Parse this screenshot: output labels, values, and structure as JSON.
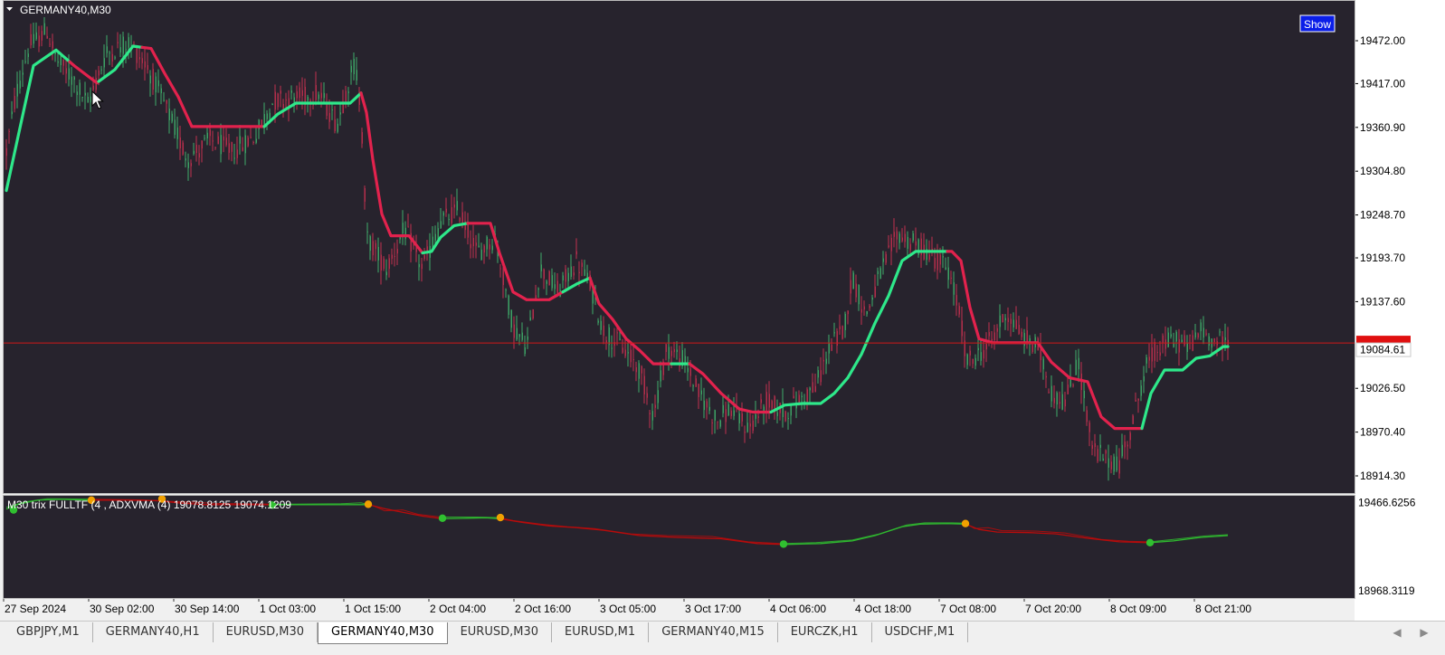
{
  "app": {
    "title": "GERMANY40,M30",
    "show_button": "Show"
  },
  "colors": {
    "background": "#27232d",
    "bull_candle": "#3fae6a",
    "bear_candle": "#c2304f",
    "trend_up": "#2ee88a",
    "trend_down": "#e2224d",
    "price_line": "#d01818",
    "axis_text": "#000000",
    "indicator_up": "#2fb82f",
    "indicator_down": "#b80b0b",
    "dot_green": "#30c030",
    "dot_orange": "#f0a000"
  },
  "chart_data": [
    {
      "type": "candlestick",
      "title": "GERMANY40,M30",
      "ylabels": [
        "19472.00",
        "19417.00",
        "19360.90",
        "19304.80",
        "19248.70",
        "19193.70",
        "19137.60",
        "19026.50",
        "18970.40",
        "18914.30"
      ],
      "yticks": [
        19472.0,
        19417.0,
        19360.9,
        19304.8,
        19248.7,
        19193.7,
        19137.6,
        19026.5,
        18970.4,
        18914.3
      ],
      "ylim": [
        18900,
        19520
      ],
      "current_price": "19084.61",
      "current_price_value": 19084.61,
      "trend_line_points": [
        [
          0,
          19280
        ],
        [
          30,
          19440
        ],
        [
          55,
          19460
        ],
        [
          75,
          19440
        ],
        [
          100,
          19418
        ],
        [
          120,
          19435
        ],
        [
          140,
          19465
        ],
        [
          160,
          19462
        ],
        [
          175,
          19430
        ],
        [
          190,
          19400
        ],
        [
          205,
          19362
        ],
        [
          225,
          19362
        ],
        [
          255,
          19362
        ],
        [
          285,
          19362
        ],
        [
          300,
          19378
        ],
        [
          320,
          19392
        ],
        [
          345,
          19392
        ],
        [
          365,
          19392
        ],
        [
          380,
          19392
        ],
        [
          392,
          19405
        ],
        [
          398,
          19380
        ],
        [
          405,
          19320
        ],
        [
          415,
          19250
        ],
        [
          425,
          19222
        ],
        [
          445,
          19222
        ],
        [
          460,
          19200
        ],
        [
          470,
          19202
        ],
        [
          480,
          19220
        ],
        [
          495,
          19235
        ],
        [
          510,
          19238
        ],
        [
          535,
          19238
        ],
        [
          545,
          19200
        ],
        [
          560,
          19150
        ],
        [
          575,
          19140
        ],
        [
          600,
          19140
        ],
        [
          615,
          19150
        ],
        [
          630,
          19160
        ],
        [
          645,
          19168
        ],
        [
          655,
          19135
        ],
        [
          670,
          19115
        ],
        [
          685,
          19090
        ],
        [
          700,
          19075
        ],
        [
          715,
          19058
        ],
        [
          735,
          19058
        ],
        [
          755,
          19058
        ],
        [
          770,
          19045
        ],
        [
          790,
          19020
        ],
        [
          810,
          19000
        ],
        [
          825,
          18996
        ],
        [
          845,
          18996
        ],
        [
          860,
          19005
        ],
        [
          880,
          19007
        ],
        [
          900,
          19007
        ],
        [
          915,
          19020
        ],
        [
          930,
          19040
        ],
        [
          945,
          19070
        ],
        [
          960,
          19110
        ],
        [
          975,
          19145
        ],
        [
          990,
          19190
        ],
        [
          1005,
          19202
        ],
        [
          1025,
          19202
        ],
        [
          1045,
          19202
        ],
        [
          1055,
          19190
        ],
        [
          1065,
          19130
        ],
        [
          1075,
          19090
        ],
        [
          1090,
          19085
        ],
        [
          1110,
          19085
        ],
        [
          1140,
          19085
        ],
        [
          1155,
          19060
        ],
        [
          1175,
          19040
        ],
        [
          1195,
          19035
        ],
        [
          1210,
          18990
        ],
        [
          1225,
          18975
        ],
        [
          1245,
          18975
        ],
        [
          1255,
          18975
        ],
        [
          1265,
          19020
        ],
        [
          1280,
          19050
        ],
        [
          1300,
          19050
        ],
        [
          1315,
          19065
        ],
        [
          1330,
          19068
        ],
        [
          1345,
          19080
        ],
        [
          1350,
          19080
        ]
      ],
      "trend_segments": [
        {
          "from": 0,
          "to": 70,
          "trend": "up"
        },
        {
          "from": 70,
          "to": 102,
          "trend": "down"
        },
        {
          "from": 102,
          "to": 150,
          "trend": "up"
        },
        {
          "from": 150,
          "to": 285,
          "trend": "down"
        },
        {
          "from": 285,
          "to": 392,
          "trend": "up"
        },
        {
          "from": 392,
          "to": 460,
          "trend": "down"
        },
        {
          "from": 460,
          "to": 510,
          "trend": "up"
        },
        {
          "from": 510,
          "to": 615,
          "trend": "down"
        },
        {
          "from": 615,
          "to": 645,
          "trend": "up"
        },
        {
          "from": 645,
          "to": 735,
          "trend": "down"
        },
        {
          "from": 735,
          "to": 755,
          "trend": "up"
        },
        {
          "from": 755,
          "to": 845,
          "trend": "down"
        },
        {
          "from": 845,
          "to": 1040,
          "trend": "up"
        },
        {
          "from": 1040,
          "to": 1255,
          "trend": "down"
        },
        {
          "from": 1255,
          "to": 1350,
          "trend": "up"
        }
      ],
      "candle_path": [
        [
          0,
          19330
        ],
        [
          10,
          19400
        ],
        [
          25,
          19465
        ],
        [
          45,
          19485
        ],
        [
          55,
          19448
        ],
        [
          75,
          19420
        ],
        [
          90,
          19390
        ],
        [
          110,
          19455
        ],
        [
          135,
          19470
        ],
        [
          155,
          19440
        ],
        [
          175,
          19390
        ],
        [
          200,
          19320
        ],
        [
          225,
          19345
        ],
        [
          250,
          19330
        ],
        [
          275,
          19350
        ],
        [
          295,
          19395
        ],
        [
          330,
          19400
        ],
        [
          345,
          19405
        ],
        [
          365,
          19365
        ],
        [
          385,
          19445
        ],
        [
          392,
          19380
        ],
        [
          398,
          19220
        ],
        [
          420,
          19180
        ],
        [
          440,
          19230
        ],
        [
          460,
          19180
        ],
        [
          480,
          19240
        ],
        [
          500,
          19255
        ],
        [
          520,
          19200
        ],
        [
          540,
          19220
        ],
        [
          560,
          19105
        ],
        [
          575,
          19080
        ],
        [
          590,
          19180
        ],
        [
          610,
          19150
        ],
        [
          630,
          19190
        ],
        [
          645,
          19160
        ],
        [
          660,
          19100
        ],
        [
          680,
          19080
        ],
        [
          700,
          19050
        ],
        [
          715,
          18990
        ],
        [
          730,
          19080
        ],
        [
          750,
          19060
        ],
        [
          765,
          19020
        ],
        [
          785,
          18985
        ],
        [
          800,
          19000
        ],
        [
          820,
          18975
        ],
        [
          840,
          19010
        ],
        [
          860,
          18995
        ],
        [
          880,
          19015
        ],
        [
          895,
          19030
        ],
        [
          910,
          19080
        ],
        [
          925,
          19100
        ],
        [
          935,
          19170
        ],
        [
          950,
          19120
        ],
        [
          965,
          19170
        ],
        [
          985,
          19225
        ],
        [
          1005,
          19210
        ],
        [
          1020,
          19200
        ],
        [
          1040,
          19180
        ],
        [
          1052,
          19130
        ],
        [
          1062,
          19060
        ],
        [
          1075,
          19070
        ],
        [
          1090,
          19090
        ],
        [
          1105,
          19125
        ],
        [
          1125,
          19090
        ],
        [
          1140,
          19080
        ],
        [
          1155,
          19020
        ],
        [
          1170,
          19010
        ],
        [
          1185,
          19060
        ],
        [
          1200,
          18950
        ],
        [
          1215,
          18935
        ],
        [
          1230,
          18930
        ],
        [
          1245,
          18985
        ],
        [
          1258,
          19050
        ],
        [
          1270,
          19075
        ],
        [
          1290,
          19090
        ],
        [
          1305,
          19080
        ],
        [
          1320,
          19100
        ],
        [
          1335,
          19088
        ],
        [
          1350,
          19085
        ]
      ]
    },
    {
      "type": "line",
      "title": "M30 trix FULLTF (4 , ADXVMA (4) 19078.8125 19074.1209",
      "ylabels": [
        "19466.6256",
        "18968.3119"
      ],
      "yticks": [
        19466.6256,
        18968.3119
      ],
      "ylim": [
        18955,
        19485
      ],
      "xlabels": [
        "27 Sep 2024",
        "30 Sep 02:00",
        "30 Sep 14:00",
        "1 Oct 03:00",
        "1 Oct 15:00",
        "2 Oct 04:00",
        "2 Oct 16:00",
        "3 Oct 05:00",
        "3 Oct 17:00",
        "4 Oct 06:00",
        "4 Oct 18:00",
        "7 Oct 08:00",
        "7 Oct 20:00",
        "8 Oct 09:00",
        "8 Oct 21:00"
      ],
      "series_main": [
        [
          0,
          19430
        ],
        [
          15,
          19460
        ],
        [
          35,
          19480
        ],
        [
          60,
          19485
        ],
        [
          90,
          19480
        ],
        [
          130,
          19480
        ],
        [
          165,
          19478
        ],
        [
          190,
          19465
        ],
        [
          220,
          19455
        ],
        [
          260,
          19455
        ],
        [
          294,
          19455
        ],
        [
          320,
          19455
        ],
        [
          360,
          19455
        ],
        [
          385,
          19455
        ],
        [
          400,
          19455
        ],
        [
          420,
          19430
        ],
        [
          440,
          19410
        ],
        [
          460,
          19390
        ],
        [
          482,
          19375
        ],
        [
          510,
          19378
        ],
        [
          530,
          19380
        ],
        [
          545,
          19375
        ],
        [
          570,
          19355
        ],
        [
          600,
          19335
        ],
        [
          630,
          19325
        ],
        [
          660,
          19310
        ],
        [
          700,
          19280
        ],
        [
          740,
          19270
        ],
        [
          790,
          19262
        ],
        [
          830,
          19235
        ],
        [
          860,
          19230
        ],
        [
          900,
          19235
        ],
        [
          935,
          19250
        ],
        [
          960,
          19280
        ],
        [
          990,
          19330
        ],
        [
          1010,
          19345
        ],
        [
          1040,
          19348
        ],
        [
          1060,
          19345
        ],
        [
          1075,
          19315
        ],
        [
          1095,
          19300
        ],
        [
          1130,
          19297
        ],
        [
          1160,
          19290
        ],
        [
          1195,
          19265
        ],
        [
          1230,
          19245
        ],
        [
          1264,
          19240
        ],
        [
          1290,
          19250
        ],
        [
          1320,
          19270
        ],
        [
          1350,
          19280
        ]
      ],
      "series_shadow": [
        [
          0,
          19440
        ],
        [
          20,
          19470
        ],
        [
          45,
          19488
        ],
        [
          75,
          19487
        ],
        [
          100,
          19485
        ],
        [
          150,
          19482
        ],
        [
          180,
          19474
        ],
        [
          200,
          19470
        ],
        [
          230,
          19462
        ],
        [
          300,
          19457
        ],
        [
          370,
          19460
        ],
        [
          392,
          19465
        ],
        [
          405,
          19450
        ],
        [
          418,
          19420
        ],
        [
          438,
          19425
        ],
        [
          455,
          19400
        ],
        [
          480,
          19385
        ],
        [
          520,
          19385
        ],
        [
          545,
          19382
        ],
        [
          560,
          19365
        ],
        [
          590,
          19345
        ],
        [
          620,
          19330
        ],
        [
          650,
          19320
        ],
        [
          690,
          19290
        ],
        [
          730,
          19280
        ],
        [
          780,
          19275
        ],
        [
          820,
          19245
        ],
        [
          855,
          19235
        ],
        [
          895,
          19240
        ],
        [
          935,
          19255
        ],
        [
          965,
          19290
        ],
        [
          995,
          19340
        ],
        [
          1015,
          19352
        ],
        [
          1045,
          19352
        ],
        [
          1060,
          19350
        ],
        [
          1070,
          19320
        ],
        [
          1085,
          19325
        ],
        [
          1100,
          19308
        ],
        [
          1140,
          19305
        ],
        [
          1170,
          19295
        ],
        [
          1210,
          19258
        ],
        [
          1240,
          19248
        ],
        [
          1264,
          19245
        ],
        [
          1290,
          19258
        ],
        [
          1325,
          19278
        ],
        [
          1350,
          19285
        ]
      ],
      "series_segments": [
        {
          "from": 0,
          "to": 94,
          "trend": "up"
        },
        {
          "from": 94,
          "to": 172,
          "trend": "down"
        },
        {
          "from": 172,
          "to": 294,
          "trend": "down"
        },
        {
          "from": 294,
          "to": 400,
          "trend": "up"
        },
        {
          "from": 400,
          "to": 482,
          "trend": "down"
        },
        {
          "from": 482,
          "to": 545,
          "trend": "up"
        },
        {
          "from": 545,
          "to": 859,
          "trend": "down"
        },
        {
          "from": 859,
          "to": 1060,
          "trend": "up"
        },
        {
          "from": 1060,
          "to": 1264,
          "trend": "down"
        },
        {
          "from": 1264,
          "to": 1350,
          "trend": "up"
        }
      ],
      "signal_dots": [
        {
          "x": 8,
          "value": 19425,
          "color": "green"
        },
        {
          "x": 94,
          "value": 19480,
          "color": "orange"
        },
        {
          "x": 172,
          "value": 19487,
          "color": "orange"
        },
        {
          "x": 294,
          "value": 19452,
          "color": "green"
        },
        {
          "x": 400,
          "value": 19457,
          "color": "orange"
        },
        {
          "x": 482,
          "value": 19378,
          "color": "green"
        },
        {
          "x": 546,
          "value": 19382,
          "color": "orange"
        },
        {
          "x": 859,
          "value": 19232,
          "color": "green"
        },
        {
          "x": 1060,
          "value": 19348,
          "color": "orange"
        },
        {
          "x": 1264,
          "value": 19240,
          "color": "green"
        }
      ]
    }
  ],
  "tabs": [
    {
      "label": "GBPJPY,M1",
      "active": false
    },
    {
      "label": "GERMANY40,H1",
      "active": false
    },
    {
      "label": "EURUSD,M30",
      "active": false
    },
    {
      "label": "GERMANY40,M30",
      "active": true
    },
    {
      "label": "EURUSD,M30",
      "active": false
    },
    {
      "label": "EURUSD,M1",
      "active": false
    },
    {
      "label": "GERMANY40,M15",
      "active": false
    },
    {
      "label": "EURCZK,H1",
      "active": false
    },
    {
      "label": "USDCHF,M1",
      "active": false
    }
  ]
}
